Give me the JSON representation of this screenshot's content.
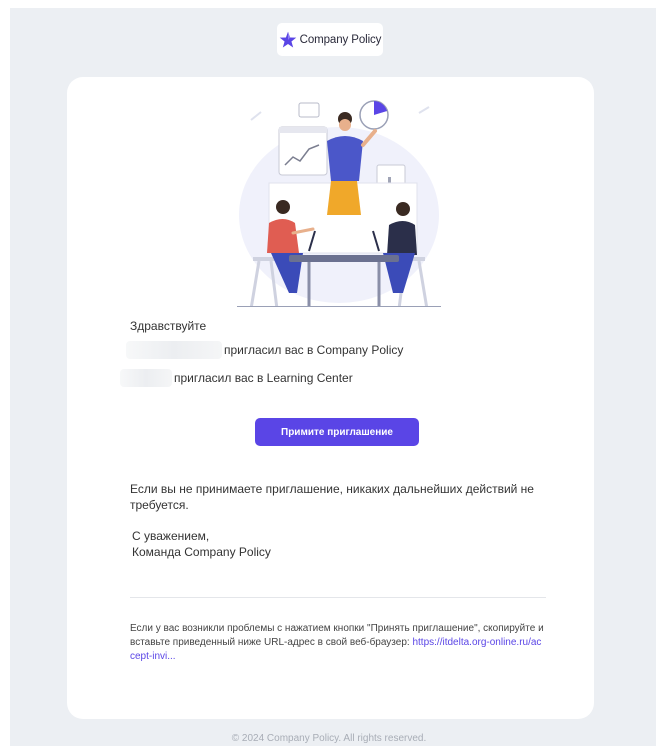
{
  "header": {
    "logo_text": "Company Policy",
    "logo_icon": "star-icon",
    "brand_color": "#5a45e6"
  },
  "email": {
    "greeting": "Здравствуйте",
    "invite_company_policy": "пригласил вас в Company Policy",
    "invite_learning_center": "пригласил вас в Learning Center",
    "accept_button_label": "Примите приглашение",
    "ignore_note": "Если вы не принимаете приглашение, никаких дальнейших действий не требуется.",
    "signoff_line1": "С уважением,",
    "signoff_line2": "Команда Company Policy",
    "help_text": "Если у вас возникли проблемы с нажатием кнопки \"Принять приглашение\", скопируйте и вставьте приведенный ниже URL-адрес в свой веб-браузер:",
    "help_link_text": "https://itdelta.org-online.ru/accept-invi..."
  },
  "footer": {
    "copyright": "© 2024 Company Policy. All rights reserved."
  }
}
